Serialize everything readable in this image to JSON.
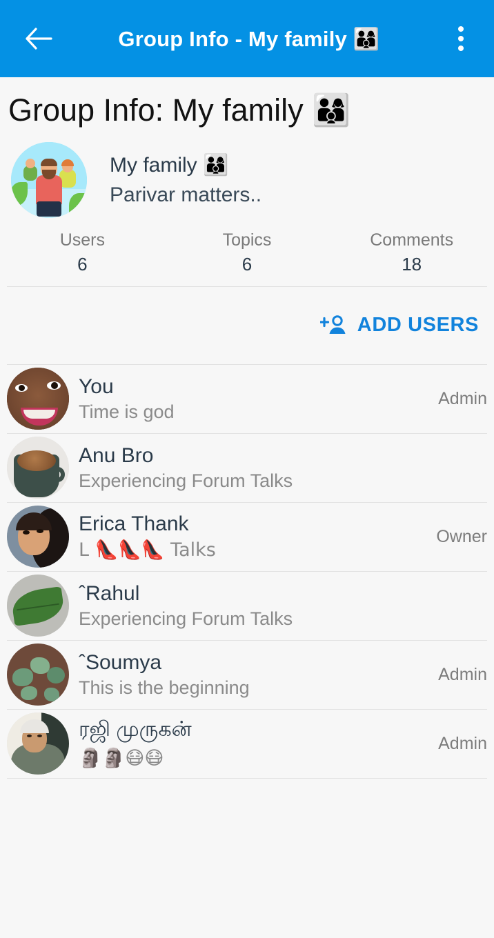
{
  "appbar": {
    "back_icon": "arrow-back-icon",
    "title": "Group Info - My family 👨‍👩‍👦",
    "overflow_icon": "more-vert-icon"
  },
  "page": {
    "heading": "Group Info: My family 👨‍👩‍👦"
  },
  "group": {
    "avatar_icon": "group-avatar-image",
    "name": "My family 👨‍👩‍👦",
    "description": "Parivar matters.."
  },
  "stats": [
    {
      "label": "Users",
      "value": "6"
    },
    {
      "label": "Topics",
      "value": "6"
    },
    {
      "label": "Comments",
      "value": "18"
    }
  ],
  "actions": {
    "add_users_label": "ADD USERS",
    "add_users_icon": "person-add-icon"
  },
  "members": [
    {
      "name": "You",
      "status": "Time is god",
      "role": "Admin",
      "avatar": "avatar-woman-smiling"
    },
    {
      "name": "Anu Bro",
      "status": "Experiencing Forum Talks",
      "role": "",
      "avatar": "avatar-coffee-mug"
    },
    {
      "name": "Erica Thank",
      "status": "L 👠👠👠 Talks",
      "role": "Owner",
      "avatar": "avatar-woman-dark-hair"
    },
    {
      "name": "ˆRahul",
      "status": "Experiencing Forum Talks",
      "role": "",
      "avatar": "avatar-green-leaf"
    },
    {
      "name": "ˆSoumya",
      "status": "This is the beginning",
      "role": "Admin",
      "avatar": "avatar-plants-soil"
    },
    {
      "name": "ரஜி முருகன்",
      "status": "🗿🗿😷😷",
      "role": "Admin",
      "avatar": "avatar-elderly-man"
    }
  ],
  "colors": {
    "appbar": "#0491e4",
    "accent": "#1283dc",
    "background": "#f7f7f7",
    "divider": "#e2e2e2",
    "primary_text": "#2b3b4a",
    "secondary_text": "#8a8a8a"
  }
}
